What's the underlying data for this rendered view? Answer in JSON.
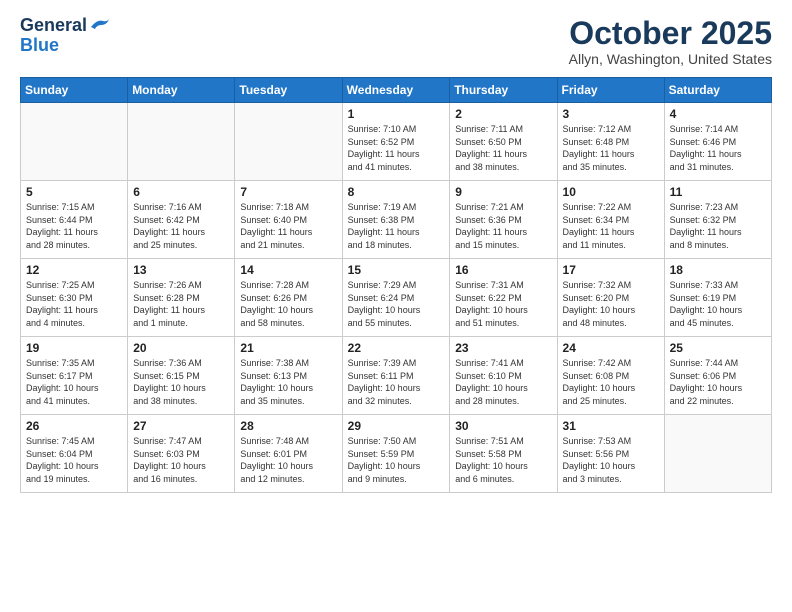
{
  "logo": {
    "line1": "General",
    "line2": "Blue"
  },
  "title": "October 2025",
  "location": "Allyn, Washington, United States",
  "days_header": [
    "Sunday",
    "Monday",
    "Tuesday",
    "Wednesday",
    "Thursday",
    "Friday",
    "Saturday"
  ],
  "weeks": [
    [
      {
        "num": "",
        "info": ""
      },
      {
        "num": "",
        "info": ""
      },
      {
        "num": "",
        "info": ""
      },
      {
        "num": "1",
        "info": "Sunrise: 7:10 AM\nSunset: 6:52 PM\nDaylight: 11 hours\nand 41 minutes."
      },
      {
        "num": "2",
        "info": "Sunrise: 7:11 AM\nSunset: 6:50 PM\nDaylight: 11 hours\nand 38 minutes."
      },
      {
        "num": "3",
        "info": "Sunrise: 7:12 AM\nSunset: 6:48 PM\nDaylight: 11 hours\nand 35 minutes."
      },
      {
        "num": "4",
        "info": "Sunrise: 7:14 AM\nSunset: 6:46 PM\nDaylight: 11 hours\nand 31 minutes."
      }
    ],
    [
      {
        "num": "5",
        "info": "Sunrise: 7:15 AM\nSunset: 6:44 PM\nDaylight: 11 hours\nand 28 minutes."
      },
      {
        "num": "6",
        "info": "Sunrise: 7:16 AM\nSunset: 6:42 PM\nDaylight: 11 hours\nand 25 minutes."
      },
      {
        "num": "7",
        "info": "Sunrise: 7:18 AM\nSunset: 6:40 PM\nDaylight: 11 hours\nand 21 minutes."
      },
      {
        "num": "8",
        "info": "Sunrise: 7:19 AM\nSunset: 6:38 PM\nDaylight: 11 hours\nand 18 minutes."
      },
      {
        "num": "9",
        "info": "Sunrise: 7:21 AM\nSunset: 6:36 PM\nDaylight: 11 hours\nand 15 minutes."
      },
      {
        "num": "10",
        "info": "Sunrise: 7:22 AM\nSunset: 6:34 PM\nDaylight: 11 hours\nand 11 minutes."
      },
      {
        "num": "11",
        "info": "Sunrise: 7:23 AM\nSunset: 6:32 PM\nDaylight: 11 hours\nand 8 minutes."
      }
    ],
    [
      {
        "num": "12",
        "info": "Sunrise: 7:25 AM\nSunset: 6:30 PM\nDaylight: 11 hours\nand 4 minutes."
      },
      {
        "num": "13",
        "info": "Sunrise: 7:26 AM\nSunset: 6:28 PM\nDaylight: 11 hours\nand 1 minute."
      },
      {
        "num": "14",
        "info": "Sunrise: 7:28 AM\nSunset: 6:26 PM\nDaylight: 10 hours\nand 58 minutes."
      },
      {
        "num": "15",
        "info": "Sunrise: 7:29 AM\nSunset: 6:24 PM\nDaylight: 10 hours\nand 55 minutes."
      },
      {
        "num": "16",
        "info": "Sunrise: 7:31 AM\nSunset: 6:22 PM\nDaylight: 10 hours\nand 51 minutes."
      },
      {
        "num": "17",
        "info": "Sunrise: 7:32 AM\nSunset: 6:20 PM\nDaylight: 10 hours\nand 48 minutes."
      },
      {
        "num": "18",
        "info": "Sunrise: 7:33 AM\nSunset: 6:19 PM\nDaylight: 10 hours\nand 45 minutes."
      }
    ],
    [
      {
        "num": "19",
        "info": "Sunrise: 7:35 AM\nSunset: 6:17 PM\nDaylight: 10 hours\nand 41 minutes."
      },
      {
        "num": "20",
        "info": "Sunrise: 7:36 AM\nSunset: 6:15 PM\nDaylight: 10 hours\nand 38 minutes."
      },
      {
        "num": "21",
        "info": "Sunrise: 7:38 AM\nSunset: 6:13 PM\nDaylight: 10 hours\nand 35 minutes."
      },
      {
        "num": "22",
        "info": "Sunrise: 7:39 AM\nSunset: 6:11 PM\nDaylight: 10 hours\nand 32 minutes."
      },
      {
        "num": "23",
        "info": "Sunrise: 7:41 AM\nSunset: 6:10 PM\nDaylight: 10 hours\nand 28 minutes."
      },
      {
        "num": "24",
        "info": "Sunrise: 7:42 AM\nSunset: 6:08 PM\nDaylight: 10 hours\nand 25 minutes."
      },
      {
        "num": "25",
        "info": "Sunrise: 7:44 AM\nSunset: 6:06 PM\nDaylight: 10 hours\nand 22 minutes."
      }
    ],
    [
      {
        "num": "26",
        "info": "Sunrise: 7:45 AM\nSunset: 6:04 PM\nDaylight: 10 hours\nand 19 minutes."
      },
      {
        "num": "27",
        "info": "Sunrise: 7:47 AM\nSunset: 6:03 PM\nDaylight: 10 hours\nand 16 minutes."
      },
      {
        "num": "28",
        "info": "Sunrise: 7:48 AM\nSunset: 6:01 PM\nDaylight: 10 hours\nand 12 minutes."
      },
      {
        "num": "29",
        "info": "Sunrise: 7:50 AM\nSunset: 5:59 PM\nDaylight: 10 hours\nand 9 minutes."
      },
      {
        "num": "30",
        "info": "Sunrise: 7:51 AM\nSunset: 5:58 PM\nDaylight: 10 hours\nand 6 minutes."
      },
      {
        "num": "31",
        "info": "Sunrise: 7:53 AM\nSunset: 5:56 PM\nDaylight: 10 hours\nand 3 minutes."
      },
      {
        "num": "",
        "info": ""
      }
    ]
  ]
}
